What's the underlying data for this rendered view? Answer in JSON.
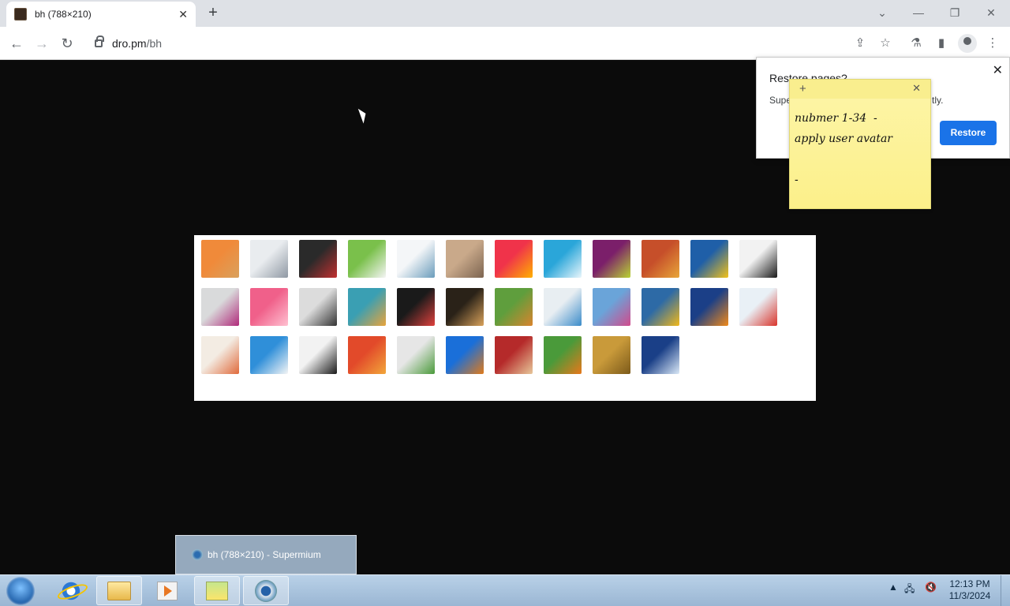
{
  "browser": {
    "tab_title": "bh (788×210)",
    "new_tab_label": "+",
    "url_host": "dro.pm",
    "url_path": "/bh"
  },
  "restore_popup": {
    "title": "Restore pages?",
    "body": "Supe",
    "body_tail": "tly.",
    "restore_label": "Restore",
    "close_label": "✕"
  },
  "sticky_note": {
    "add_label": "+",
    "close_label": "✕",
    "text": "nubmer 1-34  -\napply user avatar\n\n-"
  },
  "gallery": {
    "thumbnails": [
      {
        "name": "starfish",
        "colors": [
          "#f08a3a",
          "#d9a15d"
        ]
      },
      {
        "name": "robot",
        "colors": [
          "#e9ecef",
          "#8f98a3"
        ]
      },
      {
        "name": "turntable",
        "colors": [
          "#2a2a2a",
          "#c23030"
        ]
      },
      {
        "name": "lucky-cat",
        "colors": [
          "#7ac04b",
          "#f5f5f5"
        ]
      },
      {
        "name": "gyroscope",
        "colors": [
          "#f4f6f8",
          "#6a9cbb"
        ]
      },
      {
        "name": "kitten",
        "colors": [
          "#c9a98a",
          "#7c6450"
        ]
      },
      {
        "name": "flower",
        "colors": [
          "#f0334a",
          "#ffb000"
        ]
      },
      {
        "name": "wheel",
        "colors": [
          "#2aa6d9",
          "#e9f6fb"
        ]
      },
      {
        "name": "ball",
        "colors": [
          "#7b1f6a",
          "#b9d334"
        ]
      },
      {
        "name": "fabrics",
        "colors": [
          "#c64f2a",
          "#e8a63a"
        ]
      },
      {
        "name": "leaf",
        "colors": [
          "#1f5fa8",
          "#f2c21a"
        ]
      },
      {
        "name": "dog",
        "colors": [
          "#f2f2f2",
          "#1a1a1a"
        ]
      },
      {
        "name": "crayons",
        "colors": [
          "#d9dadb",
          "#b02a7a"
        ]
      },
      {
        "name": "star",
        "colors": [
          "#f0608a",
          "#ffc1d1"
        ]
      },
      {
        "name": "jack",
        "colors": [
          "#dcdcdc",
          "#333333"
        ]
      },
      {
        "name": "stairs",
        "colors": [
          "#3a9fb3",
          "#e9a43b"
        ]
      },
      {
        "name": "origami",
        "colors": [
          "#1a1a1a",
          "#e0413d"
        ]
      },
      {
        "name": "guitar",
        "colors": [
          "#2a2218",
          "#d9a25b"
        ]
      },
      {
        "name": "pomeranian",
        "colors": [
          "#5f9e3d",
          "#d9842d"
        ]
      },
      {
        "name": "robot-toy",
        "colors": [
          "#e8eef2",
          "#3a8bc9"
        ]
      },
      {
        "name": "scarves",
        "colors": [
          "#6aa4d9",
          "#d24a8b"
        ]
      },
      {
        "name": "sunflower",
        "colors": [
          "#2d6aa6",
          "#f2b91a"
        ]
      },
      {
        "name": "fish",
        "colors": [
          "#1b3f87",
          "#f08a1a"
        ]
      },
      {
        "name": "balloon",
        "colors": [
          "#e9f0f6",
          "#d9342b"
        ]
      },
      {
        "name": "doll",
        "colors": [
          "#f3ece3",
          "#e06a3b"
        ]
      },
      {
        "name": "sailboat",
        "colors": [
          "#2f8fd9",
          "#f5f5f5"
        ]
      },
      {
        "name": "soccer-ball",
        "colors": [
          "#f2f2f2",
          "#1a1a1a"
        ]
      },
      {
        "name": "textile",
        "colors": [
          "#e24a2a",
          "#f2a63a"
        ]
      },
      {
        "name": "marbles",
        "colors": [
          "#e6e6e6",
          "#4a9a3a"
        ]
      },
      {
        "name": "window",
        "colors": [
          "#1a6fd9",
          "#e07a1a"
        ]
      },
      {
        "name": "rug",
        "colors": [
          "#b52a2a",
          "#e7c79a"
        ]
      },
      {
        "name": "butterfly",
        "colors": [
          "#4a9a3a",
          "#e8781a"
        ]
      },
      {
        "name": "spiral",
        "colors": [
          "#c99a3a",
          "#7c5a1a"
        ]
      },
      {
        "name": "lantern",
        "colors": [
          "#1a3f87",
          "#dbe9f7"
        ]
      }
    ]
  },
  "taskbar": {
    "preview_title": "bh (788×210) - Supermium",
    "time": "12:13 PM",
    "date": "11/3/2024"
  }
}
